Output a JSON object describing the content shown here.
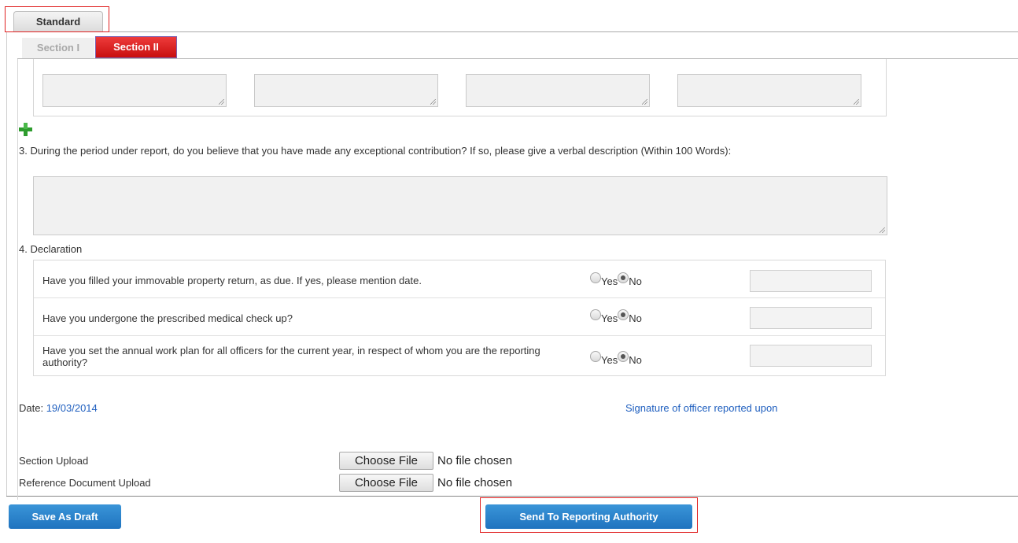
{
  "tabs": {
    "standard": "Standard",
    "section1": "Section I",
    "section2": "Section II"
  },
  "question3": "3. During the period under report, do you believe that you have made any exceptional contribution? If so, please give a verbal description (Within 100 Words):",
  "question4": "4. Declaration",
  "declaration": [
    {
      "question": "Have you filled your immovable property return, as due. If yes, please mention date.",
      "yes": "Yes",
      "no": "No",
      "selected": "No"
    },
    {
      "question": "Have you undergone the prescribed medical check up?",
      "yes": "Yes",
      "no": "No",
      "selected": "No"
    },
    {
      "question": "Have you set the annual work plan for all officers for the current year, in respect of whom you are the reporting authority?",
      "yes": "Yes",
      "no": "No",
      "selected": "No"
    }
  ],
  "date_label": "Date:",
  "date_value": "19/03/2014",
  "signature": "Signature of officer reported upon",
  "uploads": [
    {
      "label": "Section Upload",
      "button": "Choose File",
      "status": "No file chosen"
    },
    {
      "label": "Reference Document Upload",
      "button": "Choose File",
      "status": "No file chosen"
    }
  ],
  "buttons": {
    "draft": "Save As Draft",
    "send": "Send To Reporting Authority"
  },
  "colors": {
    "primary_button": "#2a84cc",
    "active_tab": "#d91c1c",
    "link": "#1f5fbf",
    "add_icon": "#2e9c2e"
  },
  "icons": {
    "add": "plus-icon"
  }
}
